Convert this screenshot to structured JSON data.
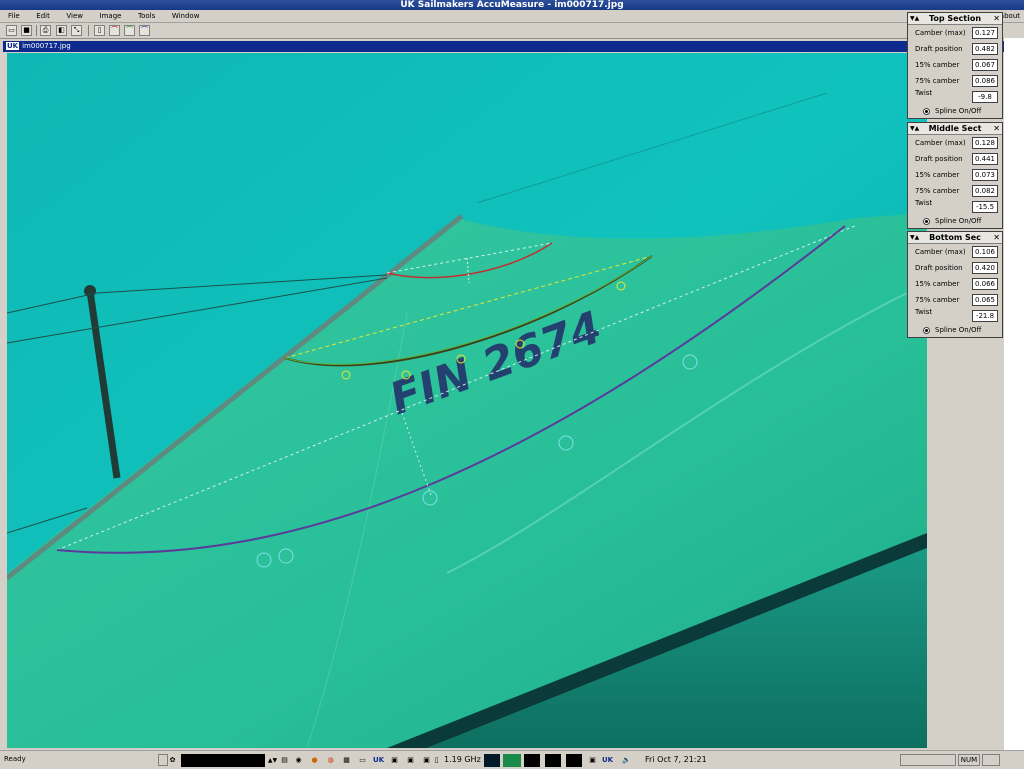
{
  "window": {
    "title": "UK Sailmakers AccuMeasure - im000717.jpg"
  },
  "menu": {
    "items": [
      "File",
      "Edit",
      "View",
      "Image",
      "Tools",
      "Window"
    ],
    "right": "about"
  },
  "child_window": {
    "badge": "UK",
    "title": "im000717.jpg"
  },
  "sail_image": {
    "sail_number_text": "FIN 2674",
    "class_text": "FIN",
    "water_color": "#0fbfb7",
    "sail_color": "#27c09a"
  },
  "sections": [
    {
      "title": "Top Section",
      "rows": [
        {
          "label": "Camber (max)",
          "value": "0.127"
        },
        {
          "label": "Draft position",
          "value": "0.482"
        },
        {
          "label": "15% camber",
          "value": "0.067"
        },
        {
          "label": "75% camber",
          "value": "0.086"
        },
        {
          "label": "Twist",
          "value": "-9.8"
        }
      ],
      "spline_label": "Spline On/Off"
    },
    {
      "title": "Middle Sect",
      "rows": [
        {
          "label": "Camber (max)",
          "value": "0.128"
        },
        {
          "label": "Draft position",
          "value": "0.441"
        },
        {
          "label": "15% camber",
          "value": "0.073"
        },
        {
          "label": "75% camber",
          "value": "0.082"
        },
        {
          "label": "Twist",
          "value": "-15.5"
        }
      ],
      "spline_label": "Spline On/Off"
    },
    {
      "title": "Bottom Sec",
      "rows": [
        {
          "label": "Camber (max)",
          "value": "0.106"
        },
        {
          "label": "Draft position",
          "value": "0.420"
        },
        {
          "label": "15% camber",
          "value": "0.066"
        },
        {
          "label": "75% camber",
          "value": "0.065"
        },
        {
          "label": "Twist",
          "value": "-21.8"
        }
      ],
      "spline_label": "Spline On/Off"
    }
  ],
  "statusbar": {
    "ready": "Ready",
    "cpu": "1.19 GHz",
    "clock": "Fri Oct  7, 21:21",
    "num": "NUM"
  }
}
